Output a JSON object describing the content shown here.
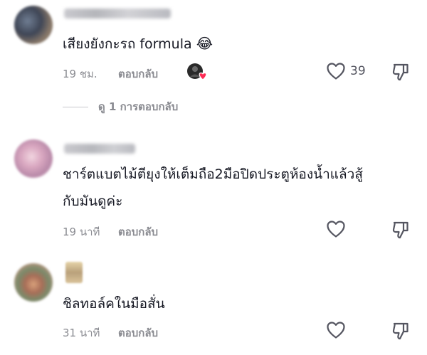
{
  "comments": [
    {
      "text": "เสียงยังกะรถ formula",
      "emoji": "😂",
      "time": "19 ชม.",
      "reply_label": "ตอบกลับ",
      "likes": "39",
      "creator_liked": true,
      "view_replies": "ดู 1 การตอบกลับ"
    },
    {
      "text_line1": "ชาร์ตแบตไม้ตียุงให้เต็มถือ2มือปิดประตูห้องน้ำแล้วสู้",
      "text_line2": "กับมันดูค่ะ",
      "time": "19 นาที",
      "reply_label": "ตอบกลับ"
    },
    {
      "text": "ชิลทอล์คในมือสั่น",
      "time": "31 นาที",
      "reply_label": "ตอบกลับ"
    }
  ]
}
